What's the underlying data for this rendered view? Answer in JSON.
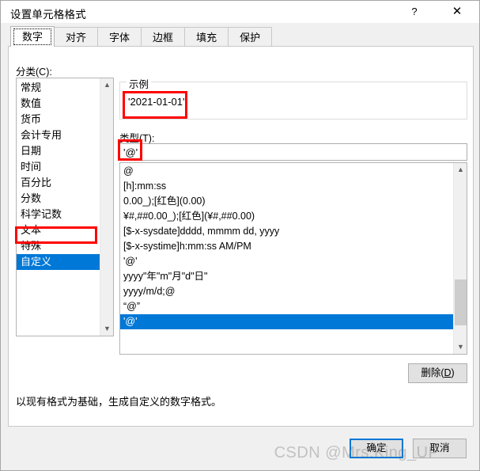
{
  "window": {
    "title": "设置单元格格式",
    "help_label": "?",
    "close_label": "✕"
  },
  "tabs": [
    {
      "label": "数字",
      "active": true
    },
    {
      "label": "对齐",
      "active": false
    },
    {
      "label": "字体",
      "active": false
    },
    {
      "label": "边框",
      "active": false
    },
    {
      "label": "填充",
      "active": false
    },
    {
      "label": "保护",
      "active": false
    }
  ],
  "category": {
    "label": "分类(C):",
    "items": [
      "常规",
      "数值",
      "货币",
      "会计专用",
      "日期",
      "时间",
      "百分比",
      "分数",
      "科学记数",
      "文本",
      "特殊",
      "自定义"
    ],
    "selected": "自定义",
    "selected_index": 11
  },
  "sample": {
    "group_title": "示例",
    "value": "'2021-01-01'"
  },
  "type": {
    "label": "类型(T):",
    "input_value": "'@'",
    "items": [
      "@",
      "[h]:mm:ss",
      "0.00_);[红色](0.00)",
      "¥#,##0.00_);[红色](¥#,##0.00)",
      "[$-x-sysdate]dddd, mmmm dd, yyyy",
      "[$-x-systime]h:mm:ss AM/PM",
      "'@'",
      "yyyy\"年\"m\"月\"d\"日\"",
      "yyyy/m/d;@",
      "“@”",
      "'@'"
    ],
    "selected_index": 10
  },
  "buttons": {
    "delete": "删除(D)",
    "delete_text": "删除(",
    "delete_accel": "D",
    "delete_tail": ")",
    "ok": "确定",
    "cancel": "取消"
  },
  "description": "以现有格式为基础，生成自定义的数字格式。",
  "watermark": "CSDN @Mrs.King_UP",
  "colors": {
    "accent": "#0078d7",
    "annotation": "#ff0000",
    "dialog_bg": "#f0f0f0",
    "panel_bg": "#ffffff"
  }
}
